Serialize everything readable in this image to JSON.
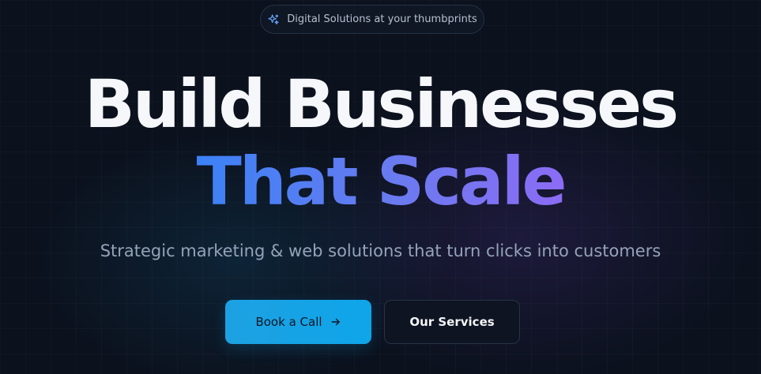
{
  "badge": {
    "icon": "sparkles-icon",
    "text": "Digital Solutions at your thumbprints"
  },
  "hero": {
    "title_line_1": "Build Businesses",
    "title_line_2": "That Scale",
    "subtitle": "Strategic marketing & web solutions that turn clicks into customers"
  },
  "actions": {
    "primary_label": "Book a Call",
    "primary_icon": "arrow-right-icon",
    "secondary_label": "Our Services"
  },
  "colors": {
    "background": "#0b111d",
    "accent_blue": "#3b82f6",
    "accent_violet": "#8b6cf5",
    "primary_button": "#0ea5e9"
  }
}
